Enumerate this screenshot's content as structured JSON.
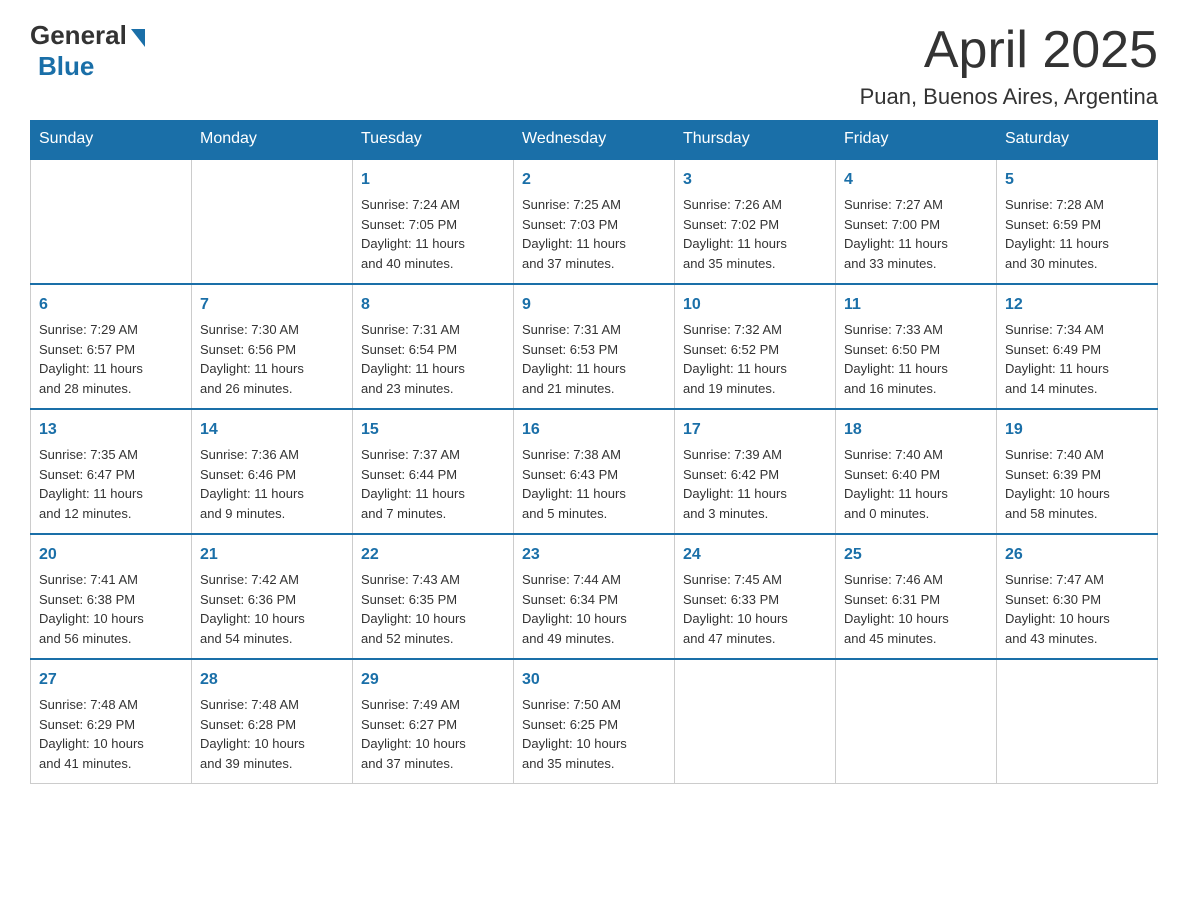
{
  "logo": {
    "general": "General",
    "blue": "Blue"
  },
  "title": "April 2025",
  "location": "Puan, Buenos Aires, Argentina",
  "days_of_week": [
    "Sunday",
    "Monday",
    "Tuesday",
    "Wednesday",
    "Thursday",
    "Friday",
    "Saturday"
  ],
  "weeks": [
    [
      {
        "day": "",
        "info": ""
      },
      {
        "day": "",
        "info": ""
      },
      {
        "day": "1",
        "info": "Sunrise: 7:24 AM\nSunset: 7:05 PM\nDaylight: 11 hours\nand 40 minutes."
      },
      {
        "day": "2",
        "info": "Sunrise: 7:25 AM\nSunset: 7:03 PM\nDaylight: 11 hours\nand 37 minutes."
      },
      {
        "day": "3",
        "info": "Sunrise: 7:26 AM\nSunset: 7:02 PM\nDaylight: 11 hours\nand 35 minutes."
      },
      {
        "day": "4",
        "info": "Sunrise: 7:27 AM\nSunset: 7:00 PM\nDaylight: 11 hours\nand 33 minutes."
      },
      {
        "day": "5",
        "info": "Sunrise: 7:28 AM\nSunset: 6:59 PM\nDaylight: 11 hours\nand 30 minutes."
      }
    ],
    [
      {
        "day": "6",
        "info": "Sunrise: 7:29 AM\nSunset: 6:57 PM\nDaylight: 11 hours\nand 28 minutes."
      },
      {
        "day": "7",
        "info": "Sunrise: 7:30 AM\nSunset: 6:56 PM\nDaylight: 11 hours\nand 26 minutes."
      },
      {
        "day": "8",
        "info": "Sunrise: 7:31 AM\nSunset: 6:54 PM\nDaylight: 11 hours\nand 23 minutes."
      },
      {
        "day": "9",
        "info": "Sunrise: 7:31 AM\nSunset: 6:53 PM\nDaylight: 11 hours\nand 21 minutes."
      },
      {
        "day": "10",
        "info": "Sunrise: 7:32 AM\nSunset: 6:52 PM\nDaylight: 11 hours\nand 19 minutes."
      },
      {
        "day": "11",
        "info": "Sunrise: 7:33 AM\nSunset: 6:50 PM\nDaylight: 11 hours\nand 16 minutes."
      },
      {
        "day": "12",
        "info": "Sunrise: 7:34 AM\nSunset: 6:49 PM\nDaylight: 11 hours\nand 14 minutes."
      }
    ],
    [
      {
        "day": "13",
        "info": "Sunrise: 7:35 AM\nSunset: 6:47 PM\nDaylight: 11 hours\nand 12 minutes."
      },
      {
        "day": "14",
        "info": "Sunrise: 7:36 AM\nSunset: 6:46 PM\nDaylight: 11 hours\nand 9 minutes."
      },
      {
        "day": "15",
        "info": "Sunrise: 7:37 AM\nSunset: 6:44 PM\nDaylight: 11 hours\nand 7 minutes."
      },
      {
        "day": "16",
        "info": "Sunrise: 7:38 AM\nSunset: 6:43 PM\nDaylight: 11 hours\nand 5 minutes."
      },
      {
        "day": "17",
        "info": "Sunrise: 7:39 AM\nSunset: 6:42 PM\nDaylight: 11 hours\nand 3 minutes."
      },
      {
        "day": "18",
        "info": "Sunrise: 7:40 AM\nSunset: 6:40 PM\nDaylight: 11 hours\nand 0 minutes."
      },
      {
        "day": "19",
        "info": "Sunrise: 7:40 AM\nSunset: 6:39 PM\nDaylight: 10 hours\nand 58 minutes."
      }
    ],
    [
      {
        "day": "20",
        "info": "Sunrise: 7:41 AM\nSunset: 6:38 PM\nDaylight: 10 hours\nand 56 minutes."
      },
      {
        "day": "21",
        "info": "Sunrise: 7:42 AM\nSunset: 6:36 PM\nDaylight: 10 hours\nand 54 minutes."
      },
      {
        "day": "22",
        "info": "Sunrise: 7:43 AM\nSunset: 6:35 PM\nDaylight: 10 hours\nand 52 minutes."
      },
      {
        "day": "23",
        "info": "Sunrise: 7:44 AM\nSunset: 6:34 PM\nDaylight: 10 hours\nand 49 minutes."
      },
      {
        "day": "24",
        "info": "Sunrise: 7:45 AM\nSunset: 6:33 PM\nDaylight: 10 hours\nand 47 minutes."
      },
      {
        "day": "25",
        "info": "Sunrise: 7:46 AM\nSunset: 6:31 PM\nDaylight: 10 hours\nand 45 minutes."
      },
      {
        "day": "26",
        "info": "Sunrise: 7:47 AM\nSunset: 6:30 PM\nDaylight: 10 hours\nand 43 minutes."
      }
    ],
    [
      {
        "day": "27",
        "info": "Sunrise: 7:48 AM\nSunset: 6:29 PM\nDaylight: 10 hours\nand 41 minutes."
      },
      {
        "day": "28",
        "info": "Sunrise: 7:48 AM\nSunset: 6:28 PM\nDaylight: 10 hours\nand 39 minutes."
      },
      {
        "day": "29",
        "info": "Sunrise: 7:49 AM\nSunset: 6:27 PM\nDaylight: 10 hours\nand 37 minutes."
      },
      {
        "day": "30",
        "info": "Sunrise: 7:50 AM\nSunset: 6:25 PM\nDaylight: 10 hours\nand 35 minutes."
      },
      {
        "day": "",
        "info": ""
      },
      {
        "day": "",
        "info": ""
      },
      {
        "day": "",
        "info": ""
      }
    ]
  ]
}
